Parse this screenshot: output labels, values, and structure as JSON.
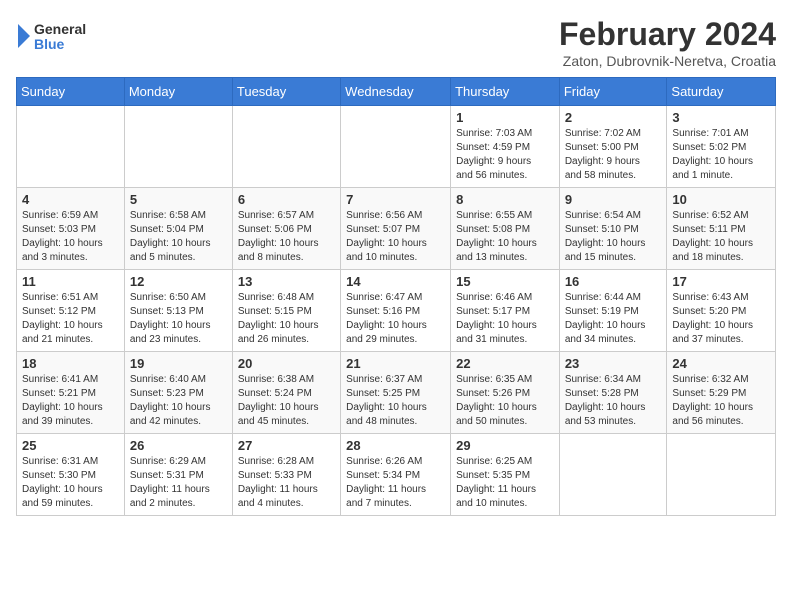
{
  "app": {
    "logo_general": "General",
    "logo_blue": "Blue",
    "month": "February 2024",
    "location": "Zaton, Dubrovnik-Neretva, Croatia"
  },
  "calendar": {
    "headers": [
      "Sunday",
      "Monday",
      "Tuesday",
      "Wednesday",
      "Thursday",
      "Friday",
      "Saturday"
    ],
    "rows": [
      [
        {
          "day": "",
          "info": ""
        },
        {
          "day": "",
          "info": ""
        },
        {
          "day": "",
          "info": ""
        },
        {
          "day": "",
          "info": ""
        },
        {
          "day": "1",
          "info": "Sunrise: 7:03 AM\nSunset: 4:59 PM\nDaylight: 9 hours\nand 56 minutes."
        },
        {
          "day": "2",
          "info": "Sunrise: 7:02 AM\nSunset: 5:00 PM\nDaylight: 9 hours\nand 58 minutes."
        },
        {
          "day": "3",
          "info": "Sunrise: 7:01 AM\nSunset: 5:02 PM\nDaylight: 10 hours\nand 1 minute."
        }
      ],
      [
        {
          "day": "4",
          "info": "Sunrise: 6:59 AM\nSunset: 5:03 PM\nDaylight: 10 hours\nand 3 minutes."
        },
        {
          "day": "5",
          "info": "Sunrise: 6:58 AM\nSunset: 5:04 PM\nDaylight: 10 hours\nand 5 minutes."
        },
        {
          "day": "6",
          "info": "Sunrise: 6:57 AM\nSunset: 5:06 PM\nDaylight: 10 hours\nand 8 minutes."
        },
        {
          "day": "7",
          "info": "Sunrise: 6:56 AM\nSunset: 5:07 PM\nDaylight: 10 hours\nand 10 minutes."
        },
        {
          "day": "8",
          "info": "Sunrise: 6:55 AM\nSunset: 5:08 PM\nDaylight: 10 hours\nand 13 minutes."
        },
        {
          "day": "9",
          "info": "Sunrise: 6:54 AM\nSunset: 5:10 PM\nDaylight: 10 hours\nand 15 minutes."
        },
        {
          "day": "10",
          "info": "Sunrise: 6:52 AM\nSunset: 5:11 PM\nDaylight: 10 hours\nand 18 minutes."
        }
      ],
      [
        {
          "day": "11",
          "info": "Sunrise: 6:51 AM\nSunset: 5:12 PM\nDaylight: 10 hours\nand 21 minutes."
        },
        {
          "day": "12",
          "info": "Sunrise: 6:50 AM\nSunset: 5:13 PM\nDaylight: 10 hours\nand 23 minutes."
        },
        {
          "day": "13",
          "info": "Sunrise: 6:48 AM\nSunset: 5:15 PM\nDaylight: 10 hours\nand 26 minutes."
        },
        {
          "day": "14",
          "info": "Sunrise: 6:47 AM\nSunset: 5:16 PM\nDaylight: 10 hours\nand 29 minutes."
        },
        {
          "day": "15",
          "info": "Sunrise: 6:46 AM\nSunset: 5:17 PM\nDaylight: 10 hours\nand 31 minutes."
        },
        {
          "day": "16",
          "info": "Sunrise: 6:44 AM\nSunset: 5:19 PM\nDaylight: 10 hours\nand 34 minutes."
        },
        {
          "day": "17",
          "info": "Sunrise: 6:43 AM\nSunset: 5:20 PM\nDaylight: 10 hours\nand 37 minutes."
        }
      ],
      [
        {
          "day": "18",
          "info": "Sunrise: 6:41 AM\nSunset: 5:21 PM\nDaylight: 10 hours\nand 39 minutes."
        },
        {
          "day": "19",
          "info": "Sunrise: 6:40 AM\nSunset: 5:23 PM\nDaylight: 10 hours\nand 42 minutes."
        },
        {
          "day": "20",
          "info": "Sunrise: 6:38 AM\nSunset: 5:24 PM\nDaylight: 10 hours\nand 45 minutes."
        },
        {
          "day": "21",
          "info": "Sunrise: 6:37 AM\nSunset: 5:25 PM\nDaylight: 10 hours\nand 48 minutes."
        },
        {
          "day": "22",
          "info": "Sunrise: 6:35 AM\nSunset: 5:26 PM\nDaylight: 10 hours\nand 50 minutes."
        },
        {
          "day": "23",
          "info": "Sunrise: 6:34 AM\nSunset: 5:28 PM\nDaylight: 10 hours\nand 53 minutes."
        },
        {
          "day": "24",
          "info": "Sunrise: 6:32 AM\nSunset: 5:29 PM\nDaylight: 10 hours\nand 56 minutes."
        }
      ],
      [
        {
          "day": "25",
          "info": "Sunrise: 6:31 AM\nSunset: 5:30 PM\nDaylight: 10 hours\nand 59 minutes."
        },
        {
          "day": "26",
          "info": "Sunrise: 6:29 AM\nSunset: 5:31 PM\nDaylight: 11 hours\nand 2 minutes."
        },
        {
          "day": "27",
          "info": "Sunrise: 6:28 AM\nSunset: 5:33 PM\nDaylight: 11 hours\nand 4 minutes."
        },
        {
          "day": "28",
          "info": "Sunrise: 6:26 AM\nSunset: 5:34 PM\nDaylight: 11 hours\nand 7 minutes."
        },
        {
          "day": "29",
          "info": "Sunrise: 6:25 AM\nSunset: 5:35 PM\nDaylight: 11 hours\nand 10 minutes."
        },
        {
          "day": "",
          "info": ""
        },
        {
          "day": "",
          "info": ""
        }
      ]
    ]
  }
}
